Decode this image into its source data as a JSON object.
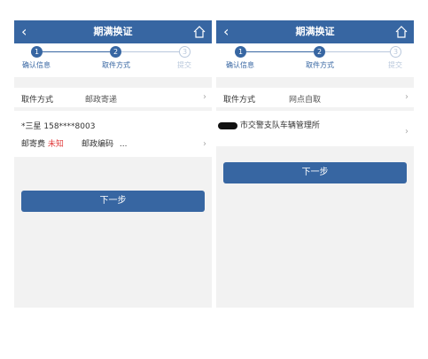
{
  "left": {
    "header": {
      "back_icon": "‹",
      "title": "期满换证"
    },
    "steps": [
      {
        "num": "1",
        "label": "确认信息",
        "state": "done"
      },
      {
        "num": "2",
        "label": "取件方式",
        "state": "current"
      },
      {
        "num": "3",
        "label": "提交",
        "state": "pending"
      }
    ],
    "pickup": {
      "label": "取件方式",
      "value": "邮政寄递",
      "chevron": "›"
    },
    "address": {
      "name_phone": "*三星   158****8003",
      "fee_label": "邮寄费",
      "fee_value": "未知",
      "postcode_label": "邮政编码",
      "postcode_value": "...",
      "chevron": "›"
    },
    "next_button": "下一步"
  },
  "right": {
    "header": {
      "back_icon": "‹",
      "title": "期满换证"
    },
    "steps": [
      {
        "num": "1",
        "label": "确认信息",
        "state": "done"
      },
      {
        "num": "2",
        "label": "取件方式",
        "state": "current"
      },
      {
        "num": "3",
        "label": "提交",
        "state": "pending"
      }
    ],
    "pickup": {
      "label": "取件方式",
      "value": "网点自取",
      "chevron": "›"
    },
    "location": {
      "name": "市交警支队车辆管理所",
      "chevron": "›"
    },
    "next_button": "下一步"
  },
  "colors": {
    "primary": "#3766a2",
    "inactive": "#b9c8dc",
    "alert": "#e03c3c",
    "background": "#f2f2f2"
  }
}
